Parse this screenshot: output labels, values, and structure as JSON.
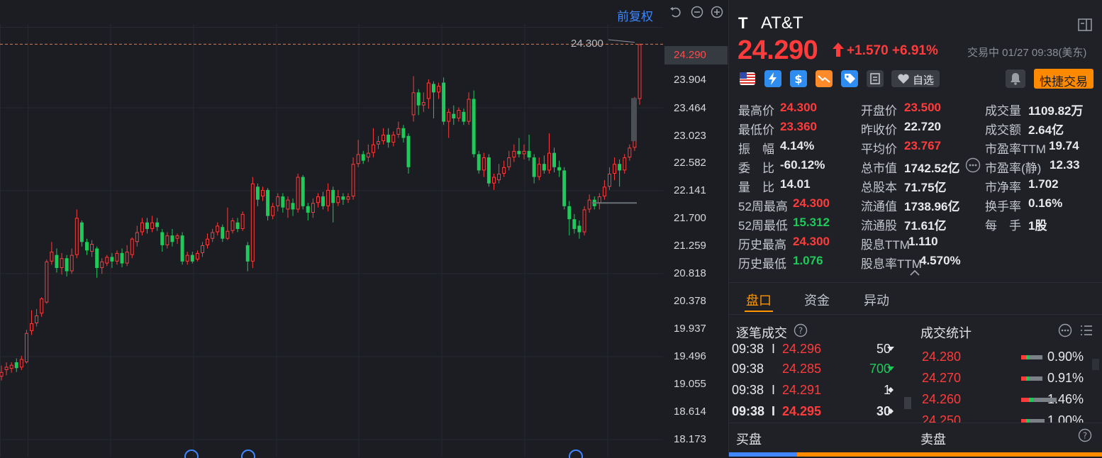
{
  "chart": {
    "adjust_label": "前复权",
    "axis_prices": [
      "23.904",
      "23.464",
      "23.023",
      "22.582",
      "22.141",
      "21.700",
      "21.259",
      "20.818",
      "20.378",
      "19.937",
      "19.496",
      "19.055",
      "18.614",
      "18.173"
    ],
    "axis_current": "24.290",
    "peak_label": "24.300",
    "colors": {
      "up": "#ff3b3b",
      "down": "#1fca5a",
      "grid": "#262930",
      "dashed": "#d47f52"
    }
  },
  "chart_data": {
    "type": "candlestick",
    "ylim": [
      17.95,
      24.6
    ],
    "current_price": 24.29,
    "peak_price": 24.3,
    "candles": [
      {
        "o": 19.18,
        "c": 19.25,
        "h": 19.35,
        "l": 19.12
      },
      {
        "o": 19.28,
        "c": 19.33,
        "h": 19.4,
        "l": 19.2
      },
      {
        "o": 19.3,
        "c": 19.36,
        "h": 19.4,
        "l": 19.24
      },
      {
        "o": 19.4,
        "c": 19.31,
        "h": 19.46,
        "l": 19.25
      },
      {
        "o": 19.32,
        "c": 19.45,
        "h": 19.5,
        "l": 19.28
      },
      {
        "o": 19.4,
        "c": 19.85,
        "h": 19.9,
        "l": 19.38
      },
      {
        "o": 19.88,
        "c": 20.0,
        "h": 20.2,
        "l": 19.82
      },
      {
        "o": 20.0,
        "c": 20.12,
        "h": 20.22,
        "l": 19.95
      },
      {
        "o": 20.15,
        "c": 20.38,
        "h": 20.4,
        "l": 20.1
      },
      {
        "o": 20.32,
        "c": 20.95,
        "h": 20.98,
        "l": 20.3
      },
      {
        "o": 20.95,
        "c": 21.1,
        "h": 21.25,
        "l": 20.9
      },
      {
        "o": 21.05,
        "c": 20.85,
        "h": 21.15,
        "l": 20.78
      },
      {
        "o": 20.85,
        "c": 21.0,
        "h": 21.08,
        "l": 20.75
      },
      {
        "o": 21.0,
        "c": 20.8,
        "h": 21.05,
        "l": 20.72
      },
      {
        "o": 20.8,
        "c": 21.05,
        "h": 21.15,
        "l": 20.76
      },
      {
        "o": 21.05,
        "c": 21.62,
        "h": 21.75,
        "l": 21.0
      },
      {
        "o": 21.55,
        "c": 21.25,
        "h": 21.58,
        "l": 21.18
      },
      {
        "o": 21.25,
        "c": 21.12,
        "h": 21.3,
        "l": 21.05
      },
      {
        "o": 21.1,
        "c": 21.22,
        "h": 21.28,
        "l": 21.02
      },
      {
        "o": 21.15,
        "c": 20.85,
        "h": 21.18,
        "l": 20.7
      },
      {
        "o": 20.85,
        "c": 20.95,
        "h": 21.0,
        "l": 20.76
      },
      {
        "o": 20.92,
        "c": 21.02,
        "h": 21.05,
        "l": 20.88
      },
      {
        "o": 21.02,
        "c": 20.95,
        "h": 21.08,
        "l": 20.85
      },
      {
        "o": 20.95,
        "c": 21.08,
        "h": 21.12,
        "l": 20.9
      },
      {
        "o": 21.08,
        "c": 20.92,
        "h": 21.15,
        "l": 20.86
      },
      {
        "o": 20.92,
        "c": 21.1,
        "h": 21.2,
        "l": 20.88
      },
      {
        "o": 21.05,
        "c": 21.3,
        "h": 21.32,
        "l": 21.0
      },
      {
        "o": 21.25,
        "c": 21.4,
        "h": 21.5,
        "l": 21.18
      },
      {
        "o": 21.4,
        "c": 21.55,
        "h": 21.62,
        "l": 21.35
      },
      {
        "o": 21.55,
        "c": 21.45,
        "h": 21.62,
        "l": 21.38
      },
      {
        "o": 21.45,
        "c": 21.55,
        "h": 21.65,
        "l": 21.4
      },
      {
        "o": 21.55,
        "c": 21.48,
        "h": 21.62,
        "l": 21.42
      },
      {
        "o": 21.4,
        "c": 21.2,
        "h": 21.45,
        "l": 21.1
      },
      {
        "o": 21.2,
        "c": 21.35,
        "h": 21.4,
        "l": 21.15
      },
      {
        "o": 21.35,
        "c": 21.25,
        "h": 21.45,
        "l": 21.18
      },
      {
        "o": 21.3,
        "c": 21.35,
        "h": 21.38,
        "l": 21.22
      },
      {
        "o": 21.35,
        "c": 20.95,
        "h": 21.4,
        "l": 20.9
      },
      {
        "o": 20.95,
        "c": 21.05,
        "h": 21.1,
        "l": 20.9
      },
      {
        "o": 21.05,
        "c": 20.95,
        "h": 21.1,
        "l": 20.92
      },
      {
        "o": 20.98,
        "c": 21.08,
        "h": 21.12,
        "l": 20.95
      },
      {
        "o": 21.08,
        "c": 21.2,
        "h": 21.25,
        "l": 21.02
      },
      {
        "o": 21.2,
        "c": 21.3,
        "h": 21.38,
        "l": 21.15
      },
      {
        "o": 21.3,
        "c": 21.4,
        "h": 21.45,
        "l": 21.25
      },
      {
        "o": 21.4,
        "c": 21.5,
        "h": 21.55,
        "l": 21.35
      },
      {
        "o": 21.48,
        "c": 21.3,
        "h": 21.52,
        "l": 21.25
      },
      {
        "o": 21.3,
        "c": 21.42,
        "h": 21.78,
        "l": 21.28
      },
      {
        "o": 21.42,
        "c": 21.58,
        "h": 21.62,
        "l": 21.38
      },
      {
        "o": 21.55,
        "c": 21.45,
        "h": 21.62,
        "l": 21.4
      },
      {
        "o": 21.45,
        "c": 21.68,
        "h": 21.72,
        "l": 21.42
      },
      {
        "o": 21.2,
        "c": 20.95,
        "h": 21.25,
        "l": 20.8
      },
      {
        "o": 20.95,
        "c": 22.15,
        "h": 22.25,
        "l": 20.85
      },
      {
        "o": 22.1,
        "c": 21.9,
        "h": 22.15,
        "l": 21.8
      },
      {
        "o": 21.95,
        "c": 22.05,
        "h": 22.1,
        "l": 21.88
      },
      {
        "o": 22.05,
        "c": 21.65,
        "h": 22.08,
        "l": 21.58
      },
      {
        "o": 21.65,
        "c": 21.8,
        "h": 21.85,
        "l": 21.6
      },
      {
        "o": 21.8,
        "c": 21.95,
        "h": 22.0,
        "l": 21.72
      },
      {
        "o": 21.95,
        "c": 21.78,
        "h": 22.0,
        "l": 21.7
      },
      {
        "o": 21.75,
        "c": 21.9,
        "h": 21.95,
        "l": 21.62
      },
      {
        "o": 21.85,
        "c": 21.75,
        "h": 21.92,
        "l": 21.65
      },
      {
        "o": 21.75,
        "c": 22.25,
        "h": 22.3,
        "l": 21.7
      },
      {
        "o": 22.25,
        "c": 21.8,
        "h": 22.28,
        "l": 21.75
      },
      {
        "o": 21.8,
        "c": 21.7,
        "h": 21.85,
        "l": 21.58
      },
      {
        "o": 21.7,
        "c": 21.85,
        "h": 21.92,
        "l": 21.62
      },
      {
        "o": 21.85,
        "c": 21.95,
        "h": 22.0,
        "l": 21.78
      },
      {
        "o": 21.95,
        "c": 21.8,
        "h": 22.02,
        "l": 21.75
      },
      {
        "o": 21.8,
        "c": 22.05,
        "h": 22.15,
        "l": 21.72
      },
      {
        "o": 22.05,
        "c": 21.85,
        "h": 22.1,
        "l": 21.55
      },
      {
        "o": 21.85,
        "c": 21.95,
        "h": 22.05,
        "l": 21.8
      },
      {
        "o": 21.95,
        "c": 21.9,
        "h": 22.0,
        "l": 21.82
      },
      {
        "o": 21.9,
        "c": 21.95,
        "h": 22.0,
        "l": 21.85
      },
      {
        "o": 21.95,
        "c": 22.45,
        "h": 22.55,
        "l": 21.9
      },
      {
        "o": 22.45,
        "c": 22.6,
        "h": 22.82,
        "l": 22.4
      },
      {
        "o": 22.6,
        "c": 22.5,
        "h": 22.65,
        "l": 22.45
      },
      {
        "o": 22.55,
        "c": 22.62,
        "h": 22.75,
        "l": 22.48
      },
      {
        "o": 22.62,
        "c": 22.75,
        "h": 23.0,
        "l": 22.55
      },
      {
        "o": 22.75,
        "c": 22.8,
        "h": 22.88,
        "l": 22.68
      },
      {
        "o": 22.8,
        "c": 22.9,
        "h": 23.0,
        "l": 22.75
      },
      {
        "o": 22.9,
        "c": 22.78,
        "h": 23.0,
        "l": 22.7
      },
      {
        "o": 22.78,
        "c": 22.9,
        "h": 22.95,
        "l": 22.72
      },
      {
        "o": 22.9,
        "c": 23.0,
        "h": 23.1,
        "l": 22.85
      },
      {
        "o": 23.0,
        "c": 22.85,
        "h": 23.05,
        "l": 22.78
      },
      {
        "o": 22.88,
        "c": 22.4,
        "h": 22.92,
        "l": 22.3
      },
      {
        "o": 23.2,
        "c": 23.55,
        "h": 23.8,
        "l": 23.1
      },
      {
        "o": 23.55,
        "c": 23.35,
        "h": 23.6,
        "l": 23.2
      },
      {
        "o": 23.35,
        "c": 23.4,
        "h": 23.55,
        "l": 23.25
      },
      {
        "o": 23.45,
        "c": 23.7,
        "h": 23.75,
        "l": 23.3
      },
      {
        "o": 23.68,
        "c": 23.55,
        "h": 23.72,
        "l": 23.15
      },
      {
        "o": 23.55,
        "c": 23.65,
        "h": 23.7,
        "l": 23.45
      },
      {
        "o": 23.7,
        "c": 23.1,
        "h": 23.78,
        "l": 23.05
      },
      {
        "o": 23.1,
        "c": 23.25,
        "h": 23.3,
        "l": 22.85
      },
      {
        "o": 23.22,
        "c": 23.15,
        "h": 23.35,
        "l": 23.05
      },
      {
        "o": 23.15,
        "c": 23.28,
        "h": 23.32,
        "l": 23.1
      },
      {
        "o": 23.25,
        "c": 23.1,
        "h": 23.3,
        "l": 23.05
      },
      {
        "o": 23.1,
        "c": 23.45,
        "h": 23.55,
        "l": 23.05
      },
      {
        "o": 23.45,
        "c": 22.6,
        "h": 23.58,
        "l": 22.55
      },
      {
        "o": 22.6,
        "c": 22.35,
        "h": 22.65,
        "l": 22.3
      },
      {
        "o": 22.35,
        "c": 22.55,
        "h": 22.62,
        "l": 22.25
      },
      {
        "o": 22.55,
        "c": 22.15,
        "h": 22.6,
        "l": 22.1
      },
      {
        "o": 22.15,
        "c": 22.25,
        "h": 22.3,
        "l": 22.05
      },
      {
        "o": 22.2,
        "c": 22.3,
        "h": 22.45,
        "l": 22.15
      },
      {
        "o": 22.3,
        "c": 22.4,
        "h": 22.5,
        "l": 22.25
      },
      {
        "o": 22.4,
        "c": 22.55,
        "h": 22.65,
        "l": 22.35
      },
      {
        "o": 22.55,
        "c": 22.65,
        "h": 22.75,
        "l": 22.48
      },
      {
        "o": 22.65,
        "c": 22.6,
        "h": 22.85,
        "l": 22.55
      },
      {
        "o": 22.6,
        "c": 22.65,
        "h": 22.75,
        "l": 22.52
      },
      {
        "o": 22.65,
        "c": 22.55,
        "h": 22.9,
        "l": 22.5
      },
      {
        "o": 22.55,
        "c": 22.25,
        "h": 22.6,
        "l": 22.15
      },
      {
        "o": 22.25,
        "c": 22.45,
        "h": 22.55,
        "l": 22.2
      },
      {
        "o": 22.45,
        "c": 22.35,
        "h": 22.58,
        "l": 22.3
      },
      {
        "o": 22.35,
        "c": 22.62,
        "h": 22.92,
        "l": 22.3
      },
      {
        "o": 22.62,
        "c": 22.4,
        "h": 22.7,
        "l": 22.32
      },
      {
        "o": 22.4,
        "c": 22.35,
        "h": 22.5,
        "l": 22.25
      },
      {
        "o": 22.35,
        "c": 21.8,
        "h": 22.4,
        "l": 21.75
      },
      {
        "o": 21.8,
        "c": 21.6,
        "h": 21.88,
        "l": 21.35
      },
      {
        "o": 21.6,
        "c": 21.45,
        "h": 21.68,
        "l": 21.38
      },
      {
        "o": 21.5,
        "c": 21.4,
        "h": 21.58,
        "l": 21.3
      },
      {
        "o": 21.4,
        "c": 21.75,
        "h": 21.8,
        "l": 21.35
      },
      {
        "o": 21.75,
        "c": 21.9,
        "h": 21.98,
        "l": 21.7
      },
      {
        "o": 21.9,
        "c": 21.8,
        "h": 21.95,
        "l": 21.75
      },
      {
        "o": 21.85,
        "c": 21.95,
        "h": 22.0,
        "l": 21.75
      },
      {
        "o": 21.95,
        "c": 22.1,
        "h": 22.2,
        "l": 21.9
      },
      {
        "o": 22.1,
        "c": 22.3,
        "h": 22.4,
        "l": 22.05
      },
      {
        "o": 22.3,
        "c": 22.45,
        "h": 22.55,
        "l": 22.2
      },
      {
        "o": 22.45,
        "c": 22.35,
        "h": 22.52,
        "l": 22.1
      },
      {
        "o": 22.35,
        "c": 22.55,
        "h": 22.6,
        "l": 22.3
      },
      {
        "o": 22.55,
        "c": 22.7,
        "h": 22.75,
        "l": 22.5
      },
      {
        "o": 22.7,
        "c": 23.45,
        "h": 23.48,
        "l": 22.65
      },
      {
        "o": 23.45,
        "c": 24.29,
        "h": 24.3,
        "l": 23.36
      }
    ]
  },
  "quote": {
    "ticker_short": "T",
    "name": "AT&T",
    "last_price": "24.290",
    "change": "+1.570 +6.91%",
    "status": "交易中 01/27 09:38(美东)",
    "watch_label": "自选",
    "quick_trade": "快捷交易"
  },
  "stats": [
    {
      "label": "最高价",
      "value": "24.300",
      "tone": "red",
      "col": 0,
      "row": 0
    },
    {
      "label": "开盘价",
      "value": "23.500",
      "tone": "red",
      "col": 1,
      "row": 0
    },
    {
      "label": "成交量",
      "value": "1109.82万",
      "tone": "white",
      "col": 2,
      "row": 0
    },
    {
      "label": "最低价",
      "value": "23.360",
      "tone": "red",
      "col": 0,
      "row": 1
    },
    {
      "label": "昨收价",
      "value": "22.720",
      "tone": "white",
      "col": 1,
      "row": 1
    },
    {
      "label": "成交额",
      "value": "2.64亿",
      "tone": "white",
      "col": 2,
      "row": 1
    },
    {
      "label": "振　幅",
      "value": "4.14%",
      "tone": "white",
      "col": 0,
      "row": 2
    },
    {
      "label": "平均价",
      "value": "23.767",
      "tone": "red",
      "col": 1,
      "row": 2
    },
    {
      "label": "市盈率TTM",
      "value": "19.74",
      "tone": "white",
      "col": 2,
      "row": 2
    },
    {
      "label": "委　比",
      "value": "-60.12%",
      "tone": "white",
      "col": 0,
      "row": 3
    },
    {
      "label": "总市值",
      "value": "1742.52亿",
      "tone": "white",
      "col": 1,
      "row": 3
    },
    {
      "label": "市盈率(静)",
      "value": "12.33",
      "tone": "white",
      "col": 2,
      "row": 3
    },
    {
      "label": "量　比",
      "value": "14.01",
      "tone": "white",
      "col": 0,
      "row": 4
    },
    {
      "label": "总股本",
      "value": "71.75亿",
      "tone": "white",
      "col": 1,
      "row": 4
    },
    {
      "label": "市净率",
      "value": "1.702",
      "tone": "white",
      "col": 2,
      "row": 4
    },
    {
      "label": "52周最高",
      "value": "24.300",
      "tone": "red",
      "col": 0,
      "row": 5
    },
    {
      "label": "流通值",
      "value": "1738.96亿",
      "tone": "white",
      "col": 1,
      "row": 5
    },
    {
      "label": "换手率",
      "value": "0.16%",
      "tone": "white",
      "col": 2,
      "row": 5
    },
    {
      "label": "52周最低",
      "value": "15.312",
      "tone": "green",
      "col": 0,
      "row": 6
    },
    {
      "label": "流通股",
      "value": "71.61亿",
      "tone": "white",
      "col": 1,
      "row": 6
    },
    {
      "label": "每　手",
      "value": "1股",
      "tone": "white",
      "col": 2,
      "row": 6
    },
    {
      "label": "历史最高",
      "value": "24.300",
      "tone": "red",
      "col": 0,
      "row": 7
    },
    {
      "label": "股息TTM",
      "value": "1.110",
      "tone": "white",
      "col": 1,
      "row": 7
    },
    {
      "label": "历史最低",
      "value": "1.076",
      "tone": "green",
      "col": 0,
      "row": 8
    },
    {
      "label": "股息率TTM",
      "value": "4.570%",
      "tone": "white",
      "col": 1,
      "row": 8
    }
  ],
  "tabs": [
    "盘口",
    "资金",
    "异动"
  ],
  "trades": {
    "title": "逐笔成交",
    "rows": [
      {
        "time": "09:38",
        "flag": "I",
        "price": "24.296",
        "qty": "50",
        "qty_tone": "white",
        "marker": "down"
      },
      {
        "time": "09:38",
        "flag": "",
        "price": "24.285",
        "qty": "700",
        "qty_tone": "green",
        "marker": "down-green"
      },
      {
        "time": "09:38",
        "flag": "I",
        "price": "24.291",
        "qty": "1",
        "qty_tone": "white",
        "marker": "diamond"
      },
      {
        "time": "09:38",
        "flag": "I",
        "price": "24.295",
        "qty": "30",
        "qty_tone": "white",
        "marker": "diamond",
        "bold": true
      }
    ]
  },
  "volume_stats": {
    "title": "成交统计",
    "rows": [
      {
        "price": "24.280",
        "pct": "0.90%",
        "frac": 0.3
      },
      {
        "price": "24.270",
        "pct": "0.91%",
        "frac": 0.3
      },
      {
        "price": "24.260",
        "pct": "1.46%",
        "frac": 0.5
      },
      {
        "price": "24.250",
        "pct": "1.00%",
        "frac": 0.33
      }
    ]
  },
  "bottom": {
    "buy": "买盘",
    "sell": "卖盘"
  }
}
